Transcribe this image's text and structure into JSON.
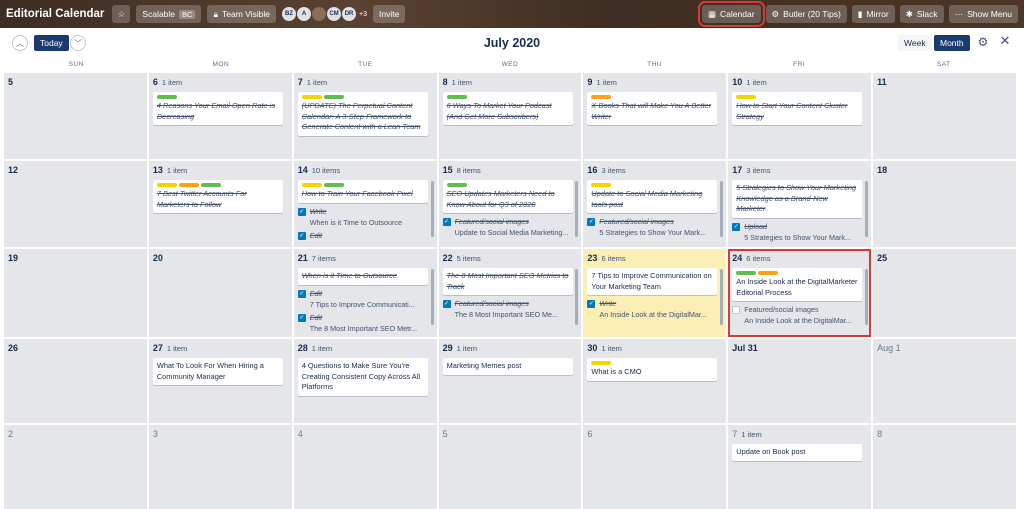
{
  "board": {
    "title": "Editorial Calendar",
    "scalable_label": "Scalable",
    "scalable_tag": "BC",
    "visibility_label": "Team Visible",
    "avatars": [
      "BZ",
      "A",
      "",
      "CM",
      "DR"
    ],
    "avatars_more": "+3",
    "invite_label": "Invite",
    "calendar_label": "Calendar",
    "butler_label": "Butler (20 Tips)",
    "mirror_label": "Mirror",
    "slack_label": "Slack",
    "menu_label": "Show Menu"
  },
  "calendar": {
    "today_label": "Today",
    "month_title": "July 2020",
    "week_label": "Week",
    "month_label": "Month",
    "day_names": [
      "SUN",
      "MON",
      "TUE",
      "WED",
      "THU",
      "FRI",
      "SAT"
    ]
  },
  "weeks": [
    [
      {
        "day": "5",
        "count": "",
        "cards": []
      },
      {
        "day": "6",
        "count": "1 item",
        "cards": [
          {
            "labels": [
              "green"
            ],
            "title": "4 Reasons Your Email Open Rate is Decreasing",
            "done": true
          }
        ]
      },
      {
        "day": "7",
        "count": "1 item",
        "cards": [
          {
            "labels": [
              "yellow",
              "green"
            ],
            "title": "(UPDATE) The Perpetual Content Calendar: A 3-Step Framework to Generate Content with a Lean Team",
            "done": true
          }
        ]
      },
      {
        "day": "8",
        "count": "1 item",
        "cards": [
          {
            "labels": [
              "green"
            ],
            "title": "6 Ways To Market Your Podcast (And Get More Subscribers)",
            "done": true
          }
        ]
      },
      {
        "day": "9",
        "count": "1 item",
        "cards": [
          {
            "labels": [
              "orange"
            ],
            "title": "X Books That will Make You A Better Writer",
            "done": true
          }
        ]
      },
      {
        "day": "10",
        "count": "1 item",
        "cards": [
          {
            "labels": [
              "yellow"
            ],
            "title": "How to Start Your Content Cluster Strategy",
            "done": true
          }
        ]
      },
      {
        "day": "11",
        "count": "",
        "cards": []
      }
    ],
    [
      {
        "day": "12",
        "count": "",
        "cards": []
      },
      {
        "day": "13",
        "count": "1 item",
        "cards": [
          {
            "labels": [
              "yellow",
              "orange",
              "green"
            ],
            "title": "7 Best Twitter Accounts For Marketers to Follow",
            "done": true
          }
        ]
      },
      {
        "day": "14",
        "count": "10 items",
        "cards": [
          {
            "labels": [
              "yellow",
              "green"
            ],
            "title": "How to Train Your Facebook Pixel",
            "done": true
          }
        ],
        "checks": [
          {
            "label": "Write",
            "done": true,
            "sub": "When is it Time to Outsource"
          },
          {
            "label": "Edit",
            "done": true,
            "sub": ""
          }
        ],
        "scroll": true
      },
      {
        "day": "15",
        "count": "8 items",
        "cards": [
          {
            "labels": [
              "green"
            ],
            "title": "SEO Updates Marketers Need to Know About for Q3 of 2020",
            "done": true
          }
        ],
        "checks": [
          {
            "label": "Featured/social images",
            "done": true,
            "sub": "Update to Social Media Marketing..."
          }
        ],
        "scroll": true
      },
      {
        "day": "16",
        "count": "3 items",
        "cards": [
          {
            "labels": [
              "yellow"
            ],
            "title": "Update to Social Media Marketing tools post",
            "done": true
          }
        ],
        "checks": [
          {
            "label": "Featured/social images",
            "done": true,
            "sub": "5 Strategies to Show Your Mark..."
          }
        ],
        "scroll": true
      },
      {
        "day": "17",
        "count": "3 items",
        "cards": [
          {
            "labels": [],
            "title": "5 Strategies to Show Your Marketing Knowledge as a Brand-New Marketer",
            "done": true
          }
        ],
        "checks": [
          {
            "label": "Upload",
            "done": true,
            "sub": "5 Strategies to Show Your Mark..."
          }
        ],
        "scroll": true
      },
      {
        "day": "18",
        "count": "",
        "cards": []
      }
    ],
    [
      {
        "day": "19",
        "count": "",
        "cards": []
      },
      {
        "day": "20",
        "count": "",
        "cards": []
      },
      {
        "day": "21",
        "count": "7 items",
        "cards": [
          {
            "labels": [],
            "title": "When is it Time to Outsource",
            "done": true
          }
        ],
        "checks": [
          {
            "label": "Edit",
            "done": true,
            "sub": "7 Tips to Improve Communicati..."
          },
          {
            "label": "Edit",
            "done": true,
            "sub": "The 8 Most Important SEO Metr..."
          }
        ],
        "scroll": true
      },
      {
        "day": "22",
        "count": "5 items",
        "cards": [
          {
            "labels": [],
            "title": "The 8 Most Important SEO Metrics to Track",
            "done": true
          }
        ],
        "checks": [
          {
            "label": "Featured/social images",
            "done": true,
            "sub": "The 8 Most Important SEO Me..."
          }
        ],
        "scroll": true
      },
      {
        "day": "23",
        "count": "6 items",
        "today": true,
        "cards": [
          {
            "labels": [],
            "title": "7 Tips to Improve Communication on Your Marketing Team",
            "done": false
          }
        ],
        "checks": [
          {
            "label": "Write",
            "done": true,
            "sub": "An Inside Look at the DigitalMar..."
          }
        ],
        "scroll": true
      },
      {
        "day": "24",
        "count": "6 items",
        "focus": true,
        "cards": [
          {
            "labels": [
              "green",
              "orange"
            ],
            "title": "An Inside Look at the DigitalMarketer Editorial Process",
            "done": false
          }
        ],
        "checks": [
          {
            "label": "Featured/social images",
            "done": false,
            "sub": "An Inside Look at the DigitalMar..."
          }
        ],
        "scroll": true
      },
      {
        "day": "25",
        "count": "",
        "cards": []
      }
    ],
    [
      {
        "day": "26",
        "count": "",
        "cards": []
      },
      {
        "day": "27",
        "count": "1 item",
        "cards": [
          {
            "labels": [],
            "title": "What To Look For When Hiring a Community Manager",
            "done": false
          }
        ]
      },
      {
        "day": "28",
        "count": "1 item",
        "cards": [
          {
            "labels": [],
            "title": "4 Questions to Make Sure You're Creating Consistent Copy Across All Platforms",
            "done": false
          }
        ]
      },
      {
        "day": "29",
        "count": "1 item",
        "cards": [
          {
            "labels": [],
            "title": "Marketing Memes post",
            "done": false
          }
        ]
      },
      {
        "day": "30",
        "count": "1 item",
        "cards": [
          {
            "labels": [
              "yellow"
            ],
            "title": "What is a CMO",
            "done": false
          }
        ]
      },
      {
        "day": "Jul 31",
        "count": "",
        "cards": []
      },
      {
        "day": "Aug 1",
        "count": "",
        "faded": true,
        "cards": []
      }
    ],
    [
      {
        "day": "2",
        "count": "",
        "faded": true,
        "cards": []
      },
      {
        "day": "3",
        "count": "",
        "faded": true,
        "cards": []
      },
      {
        "day": "4",
        "count": "",
        "faded": true,
        "cards": []
      },
      {
        "day": "5",
        "count": "",
        "faded": true,
        "cards": []
      },
      {
        "day": "6",
        "count": "",
        "faded": true,
        "cards": []
      },
      {
        "day": "7",
        "count": "1 item",
        "faded": true,
        "cards": [
          {
            "labels": [],
            "title": "Update on Book post",
            "done": false
          }
        ]
      },
      {
        "day": "8",
        "count": "",
        "faded": true,
        "cards": []
      }
    ]
  ]
}
